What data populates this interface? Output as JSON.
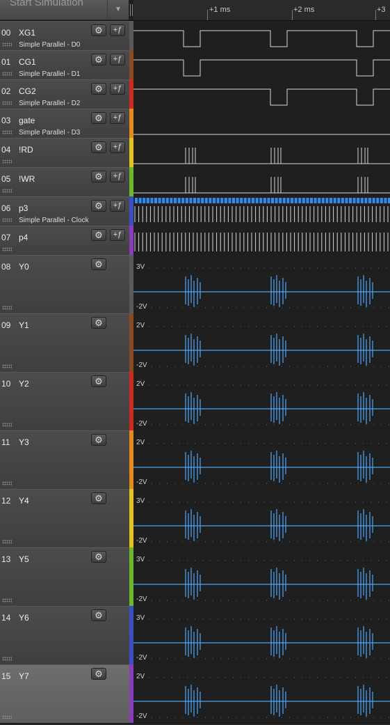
{
  "toolbar": {
    "start_simulation_label": "Start Simulation",
    "dropdown_icon": "chevron-down-icon"
  },
  "ruler": {
    "labels": [
      "+1 ms",
      "+2 ms",
      "+3"
    ]
  },
  "icons": {
    "settings": "gear-icon",
    "trigger": "trigger-edge-icon"
  },
  "digital_channels": [
    {
      "num": "00",
      "name": "XG1",
      "subtitle": "Simple Parallel - D0",
      "color": "#5a5a5a"
    },
    {
      "num": "01",
      "name": "CG1",
      "subtitle": "Simple Parallel - D1",
      "color": "#8a4a22"
    },
    {
      "num": "02",
      "name": "CG2",
      "subtitle": "Simple Parallel - D2",
      "color": "#d02a1e"
    },
    {
      "num": "03",
      "name": "gate",
      "subtitle": "Simple Parallel - D3",
      "color": "#e88a1a"
    },
    {
      "num": "04",
      "name": "!RD",
      "subtitle": "",
      "color": "#e6c21c"
    },
    {
      "num": "05",
      "name": "!WR",
      "subtitle": "",
      "color": "#6bb82a"
    },
    {
      "num": "06",
      "name": "p3",
      "subtitle": "Simple Parallel - Clock",
      "color": "#3a4fc4"
    },
    {
      "num": "07",
      "name": "p4",
      "subtitle": "",
      "color": "#8a3cc0"
    }
  ],
  "analog_channels": [
    {
      "num": "08",
      "name": "Y0",
      "top_label": "3V",
      "bottom_label": "-2V",
      "color": "#5a5a5a"
    },
    {
      "num": "09",
      "name": "Y1",
      "top_label": "2V",
      "bottom_label": "-2V",
      "color": "#8a4a22"
    },
    {
      "num": "10",
      "name": "Y2",
      "top_label": "2V",
      "bottom_label": "-2V",
      "color": "#d02a1e"
    },
    {
      "num": "11",
      "name": "Y3",
      "top_label": "2V",
      "bottom_label": "-2V",
      "color": "#e88a1a"
    },
    {
      "num": "12",
      "name": "Y4",
      "top_label": "3V",
      "bottom_label": "-2V",
      "color": "#e6c21c"
    },
    {
      "num": "13",
      "name": "Y5",
      "top_label": "3V",
      "bottom_label": "-2V",
      "color": "#6bb82a"
    },
    {
      "num": "14",
      "name": "Y6",
      "top_label": "3V",
      "bottom_label": "-2V",
      "color": "#3a4fc4"
    },
    {
      "num": "15",
      "name": "Y7",
      "top_label": "2V",
      "bottom_label": "-2V",
      "color": "#8a3cc0"
    }
  ],
  "selected_channel": "15",
  "colors": {
    "analog_trace": "#4aa3f0",
    "digital_trace": "#d8d8d8",
    "clock_marker": "#2f8cf0"
  }
}
